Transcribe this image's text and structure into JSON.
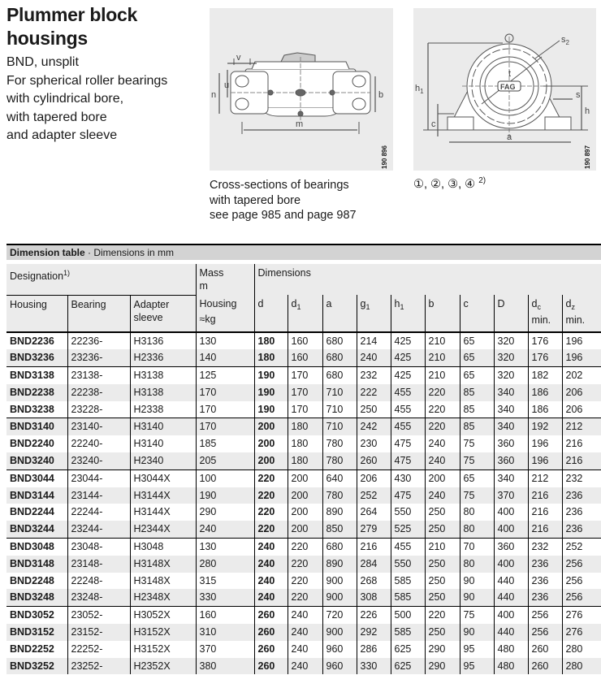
{
  "header": {
    "title_line1": "Plummer block",
    "title_line2": "housings",
    "subtitle_lines": [
      "BND, unsplit",
      "For spherical roller bearings",
      "with cylindrical bore,",
      "with tapered bore",
      "and adapter sleeve"
    ]
  },
  "figures": {
    "fig1": {
      "code": "190 896",
      "labels": {
        "v": "v",
        "u": "u",
        "n": "n",
        "b": "b",
        "m": "m"
      },
      "caption_lines": [
        "Cross-sections of bearings",
        "with tapered bore",
        "see page 985 and page 987"
      ]
    },
    "fig2": {
      "code": "190 897",
      "labels": {
        "s2": "s",
        "s2_sub": "2",
        "t": "t",
        "h1": "h",
        "h1_sub": "1",
        "s": "s",
        "h": "h",
        "c": "c",
        "a": "a",
        "logo": "FAG"
      },
      "refs": "①, ②, ③, ④",
      "refs_note": "2)"
    }
  },
  "table": {
    "bar_bold": "Dimension table",
    "bar_rest": " · Dimensions in mm",
    "header1": {
      "designation": "Designation",
      "designation_note": "1)",
      "mass_line1": "Mass",
      "mass_line2": "m",
      "dimensions": "Dimensions"
    },
    "header2": {
      "housing": "Housing",
      "bearing": "Bearing",
      "adapter_line1": "Adapter",
      "adapter_line2": "sleeve",
      "mass_housing": "Housing",
      "mass_unit": "≈kg",
      "d": "d",
      "d1": "d",
      "d1_sub": "1",
      "a": "a",
      "g1": "g",
      "g1_sub": "1",
      "h1": "h",
      "h1_sub": "1",
      "b": "b",
      "c": "c",
      "D": "D",
      "dc": "d",
      "dc_sub": "c",
      "dc_min": "min.",
      "dz": "d",
      "dz_sub": "z",
      "dz_min": "min."
    },
    "rows": [
      [
        "BND2236",
        "22236-",
        "H3136",
        "130",
        "180",
        "160",
        "680",
        "214",
        "425",
        "210",
        "65",
        "320",
        "176",
        "196"
      ],
      [
        "BND3236",
        "23236-",
        "H2336",
        "140",
        "180",
        "160",
        "680",
        "240",
        "425",
        "210",
        "65",
        "320",
        "176",
        "196"
      ],
      [
        "BND3138",
        "23138-",
        "H3138",
        "125",
        "190",
        "170",
        "680",
        "232",
        "425",
        "210",
        "65",
        "320",
        "182",
        "202"
      ],
      [
        "BND2238",
        "22238-",
        "H3138",
        "170",
        "190",
        "170",
        "710",
        "222",
        "455",
        "220",
        "85",
        "340",
        "186",
        "206"
      ],
      [
        "BND3238",
        "23228-",
        "H2338",
        "170",
        "190",
        "170",
        "710",
        "250",
        "455",
        "220",
        "85",
        "340",
        "186",
        "206"
      ],
      [
        "BND3140",
        "23140-",
        "H3140",
        "170",
        "200",
        "180",
        "710",
        "242",
        "455",
        "220",
        "85",
        "340",
        "192",
        "212"
      ],
      [
        "BND2240",
        "22240-",
        "H3140",
        "185",
        "200",
        "180",
        "780",
        "230",
        "475",
        "240",
        "75",
        "360",
        "196",
        "216"
      ],
      [
        "BND3240",
        "23240-",
        "H2340",
        "205",
        "200",
        "180",
        "780",
        "260",
        "475",
        "240",
        "75",
        "360",
        "196",
        "216"
      ],
      [
        "BND3044",
        "23044-",
        "H3044X",
        "100",
        "220",
        "200",
        "640",
        "206",
        "430",
        "200",
        "65",
        "340",
        "212",
        "232"
      ],
      [
        "BND3144",
        "23144-",
        "H3144X",
        "190",
        "220",
        "200",
        "780",
        "252",
        "475",
        "240",
        "75",
        "370",
        "216",
        "236"
      ],
      [
        "BND2244",
        "22244-",
        "H3144X",
        "290",
        "220",
        "200",
        "890",
        "264",
        "550",
        "250",
        "80",
        "400",
        "216",
        "236"
      ],
      [
        "BND3244",
        "23244-",
        "H2344X",
        "240",
        "220",
        "200",
        "850",
        "279",
        "525",
        "250",
        "80",
        "400",
        "216",
        "236"
      ],
      [
        "BND3048",
        "23048-",
        "H3048",
        "130",
        "240",
        "220",
        "680",
        "216",
        "455",
        "210",
        "70",
        "360",
        "232",
        "252"
      ],
      [
        "BND3148",
        "23148-",
        "H3148X",
        "280",
        "240",
        "220",
        "890",
        "284",
        "550",
        "250",
        "80",
        "400",
        "236",
        "256"
      ],
      [
        "BND2248",
        "22248-",
        "H3148X",
        "315",
        "240",
        "220",
        "900",
        "268",
        "585",
        "250",
        "90",
        "440",
        "236",
        "256"
      ],
      [
        "BND3248",
        "23248-",
        "H2348X",
        "330",
        "240",
        "220",
        "900",
        "308",
        "585",
        "250",
        "90",
        "440",
        "236",
        "256"
      ],
      [
        "BND3052",
        "23052-",
        "H3052X",
        "160",
        "260",
        "240",
        "720",
        "226",
        "500",
        "220",
        "75",
        "400",
        "256",
        "276"
      ],
      [
        "BND3152",
        "23152-",
        "H3152X",
        "310",
        "260",
        "240",
        "900",
        "292",
        "585",
        "250",
        "90",
        "440",
        "256",
        "276"
      ],
      [
        "BND2252",
        "22252-",
        "H3152X",
        "370",
        "260",
        "240",
        "960",
        "286",
        "625",
        "290",
        "95",
        "480",
        "260",
        "280"
      ],
      [
        "BND3252",
        "23252-",
        "H2352X",
        "380",
        "260",
        "240",
        "960",
        "330",
        "625",
        "290",
        "95",
        "480",
        "260",
        "280"
      ]
    ],
    "group_starts": [
      0,
      2,
      5,
      8,
      12,
      16
    ]
  }
}
